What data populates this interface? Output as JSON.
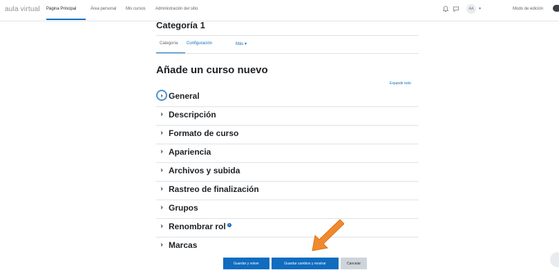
{
  "navbar": {
    "brand": "aula virtual",
    "links": [
      "Página Principal",
      "Área personal",
      "Mis cursos",
      "Administración del sitio"
    ],
    "avatar_initials": "AA",
    "avatar_caret": "▾",
    "edit_mode_label": "Modo de edición"
  },
  "page": {
    "title": "Categoría 1",
    "tabs": [
      "Categoría",
      "Configuración",
      "Más ▾"
    ],
    "heading": "Añade un curso nuevo",
    "expand_all": "Expandir todo"
  },
  "sections": [
    {
      "label": "General"
    },
    {
      "label": "Descripción"
    },
    {
      "label": "Formato de curso"
    },
    {
      "label": "Apariencia"
    },
    {
      "label": "Archivos y subida"
    },
    {
      "label": "Rastreo de finalización"
    },
    {
      "label": "Grupos"
    },
    {
      "label": "Renombrar rol"
    },
    {
      "label": "Marcas"
    }
  ],
  "chevron": "›",
  "info_icon": "?",
  "buttons": {
    "save_return": "Guardar y volver",
    "save_display": "Guardar cambios y mostrar",
    "cancel": "Cancelar"
  },
  "colors": {
    "primary": "#0f6cbf",
    "arrow": "#f08a2c"
  }
}
